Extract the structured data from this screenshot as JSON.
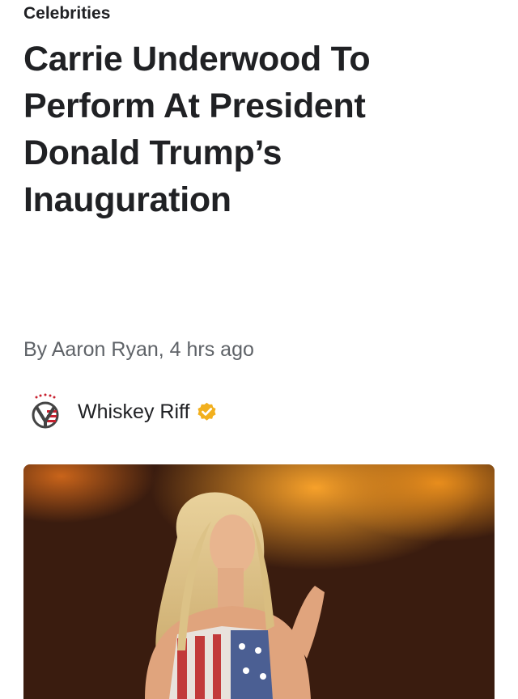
{
  "article": {
    "category": "Celebrities",
    "headline": "Carrie Underwood To Perform At President Donald Trump’s Inauguration",
    "byline": "By Aaron Ryan, 4 hrs ago"
  },
  "publisher": {
    "name": "Whiskey Riff",
    "logo_icon": "whiskey-riff-logo",
    "verified_icon": "verified-badge-icon",
    "verified_color": "#f2b01e"
  },
  "hero_image": {
    "subject": "performer-on-stage-photo"
  },
  "colors": {
    "text_primary": "#202124",
    "text_secondary": "#5f6368",
    "background": "#ffffff"
  }
}
